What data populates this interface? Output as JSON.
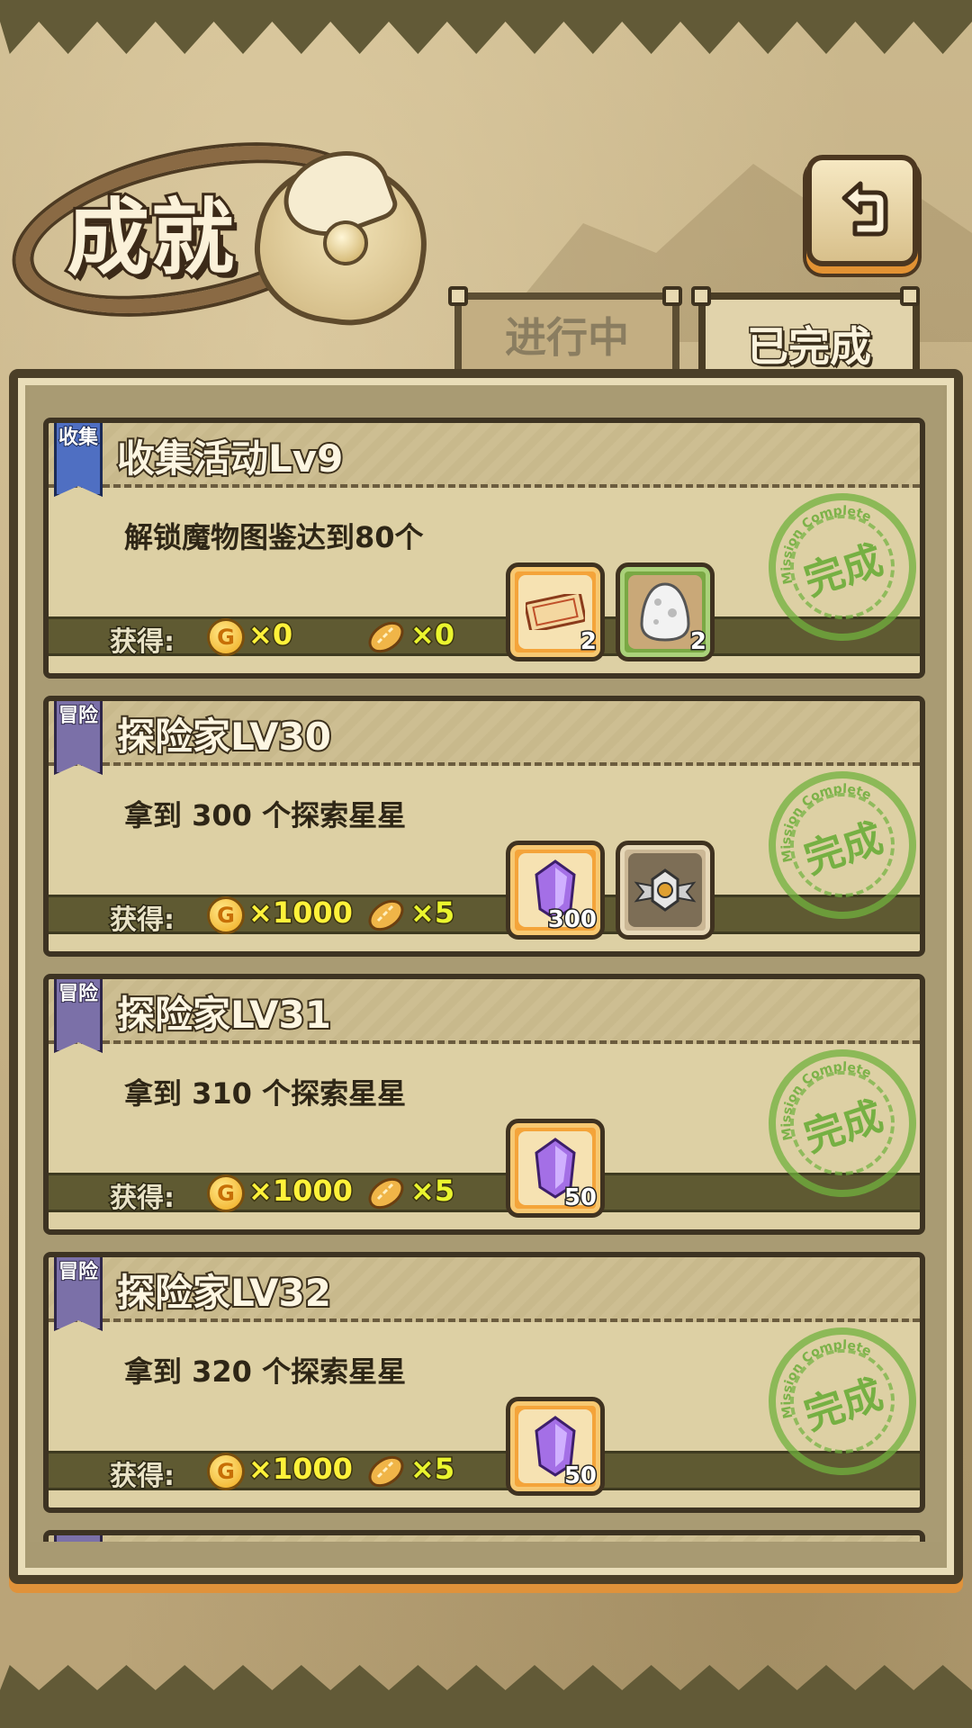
{
  "screen": {
    "title": "成就"
  },
  "tabs": [
    {
      "label": "进行中",
      "active": false
    },
    {
      "label": "已完成",
      "active": true
    }
  ],
  "back_button": {
    "icon": "back-arrow-icon"
  },
  "reward_label": "获得:",
  "stamp_text": "完成",
  "stamp_ring_text": "Mission Complete",
  "colors": {
    "accent": "#f4a43a",
    "stamp": "#70b23e",
    "coin": "#fff23a"
  },
  "achievements": [
    {
      "category": "收集",
      "category_color": "#4f6fc2",
      "title": "收集活动Lv9",
      "description": "解锁魔物图鉴达到80个",
      "coins": "×0",
      "bread": "×0",
      "items": [
        {
          "icon": "ticket-icon",
          "count": "2",
          "frame": "orange"
        },
        {
          "icon": "egg-icon",
          "count": "2",
          "frame": "green"
        }
      ],
      "completed": true
    },
    {
      "category": "冒险",
      "category_color": "#7b70a8",
      "title": "探险家LV30",
      "description": "拿到 300 个探索星星",
      "coins": "×1000",
      "bread": "×5",
      "items": [
        {
          "icon": "purple-gem-icon",
          "count": "300",
          "frame": "orange"
        },
        {
          "icon": "winged-medal-icon",
          "count": "",
          "frame": "grey"
        }
      ],
      "completed": true
    },
    {
      "category": "冒险",
      "category_color": "#7b70a8",
      "title": "探险家LV31",
      "description": "拿到 310 个探索星星",
      "coins": "×1000",
      "bread": "×5",
      "items": [
        {
          "icon": "purple-gem-icon",
          "count": "50",
          "frame": "orange"
        }
      ],
      "completed": true
    },
    {
      "category": "冒险",
      "category_color": "#7b70a8",
      "title": "探险家LV32",
      "description": "拿到 320 个探索星星",
      "coins": "×1000",
      "bread": "×5",
      "items": [
        {
          "icon": "purple-gem-icon",
          "count": "50",
          "frame": "orange"
        }
      ],
      "completed": true
    }
  ]
}
